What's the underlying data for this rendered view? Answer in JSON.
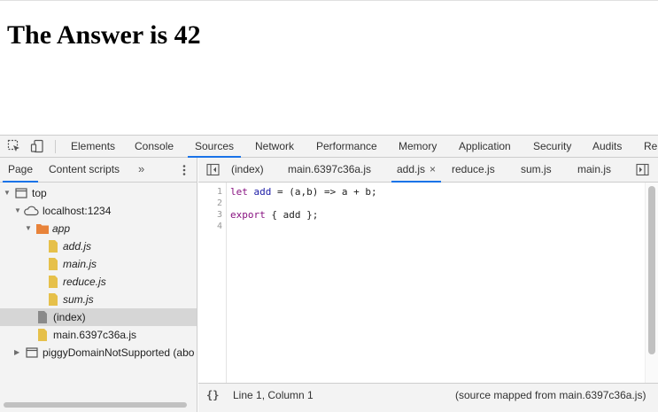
{
  "page": {
    "heading": "The Answer is 42"
  },
  "devtools": {
    "main_tabs": [
      "Elements",
      "Console",
      "Sources",
      "Network",
      "Performance",
      "Memory",
      "Application",
      "Security",
      "Audits",
      "Re"
    ],
    "active_main_tab": "Sources",
    "navigator": {
      "tabs": [
        "Page",
        "Content scripts"
      ],
      "active_tab": "Page",
      "more": "»",
      "tree": [
        {
          "label": "top",
          "icon": "frame-icon"
        },
        {
          "label": "localhost:1234",
          "icon": "cloud-icon"
        },
        {
          "label": "app",
          "icon": "folder-icon"
        },
        {
          "label": "add.js",
          "icon": "file-icon"
        },
        {
          "label": "main.js",
          "icon": "file-icon"
        },
        {
          "label": "reduce.js",
          "icon": "file-icon"
        },
        {
          "label": "sum.js",
          "icon": "file-icon"
        },
        {
          "label": "(index)",
          "icon": "file-icon",
          "selected": true
        },
        {
          "label": "main.6397c36a.js",
          "icon": "file-icon"
        },
        {
          "label": "piggyDomainNotSupported (abo",
          "icon": "frame-icon"
        }
      ]
    },
    "editor": {
      "tabs": [
        "(index)",
        "main.6397c36a.js",
        "add.js",
        "reduce.js",
        "sum.js",
        "main.js"
      ],
      "active_tab": "add.js",
      "close_glyph": "×",
      "line_numbers": [
        "1",
        "2",
        "3",
        "4"
      ],
      "code": {
        "line1": {
          "kw": "let",
          "id": "add",
          "rest": " = (a,b) => a + b;"
        },
        "line3": {
          "kw": "export",
          "rest": " { add };"
        }
      }
    },
    "status": {
      "pretty_print": "{}",
      "position": "Line 1, Column 1",
      "source_map": "(source mapped from main.6397c36a.js)"
    }
  },
  "colors": {
    "accent": "#1a73e8",
    "folder": "#e8833a",
    "file": "#e6c04a",
    "keyword": "#881280",
    "identifier": "#1a1aa6"
  }
}
